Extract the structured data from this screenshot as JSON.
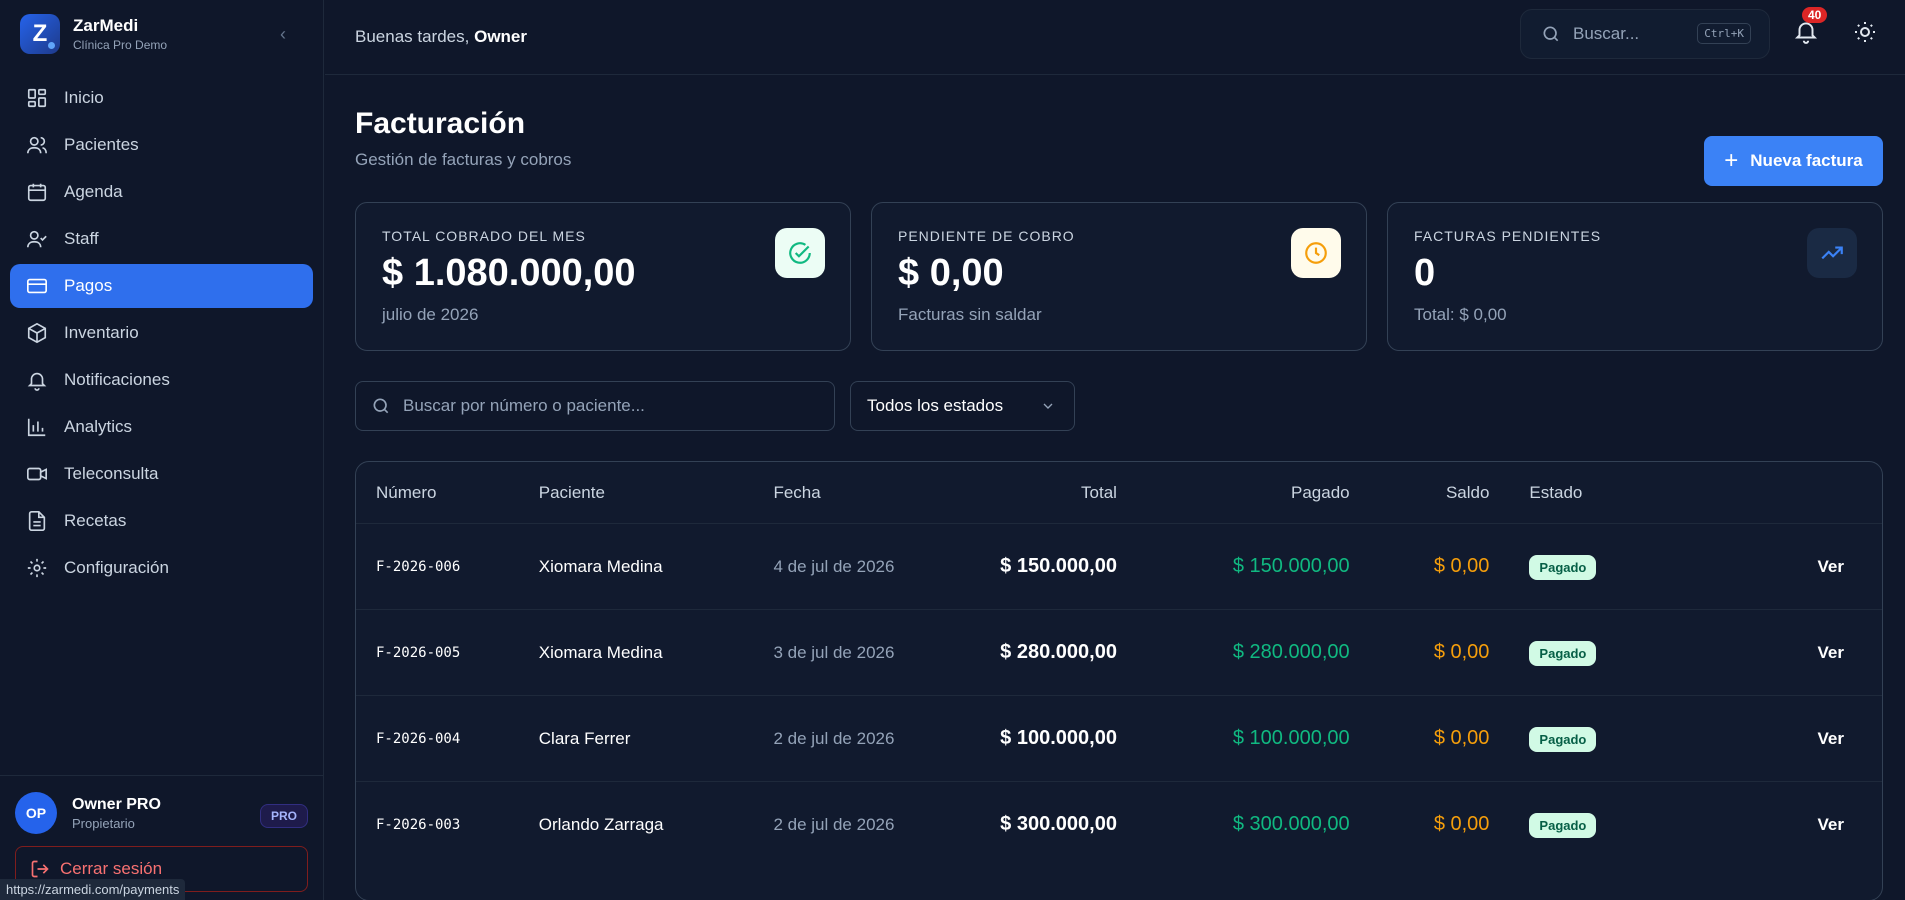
{
  "sidebar": {
    "brand_name": "ZarMedi",
    "brand_sub": "Clínica Pro Demo",
    "logo_letter": "Z",
    "items": [
      {
        "label": "Inicio",
        "icon": "grid-icon"
      },
      {
        "label": "Pacientes",
        "icon": "users-icon"
      },
      {
        "label": "Agenda",
        "icon": "calendar-icon"
      },
      {
        "label": "Staff",
        "icon": "user-check-icon"
      },
      {
        "label": "Pagos",
        "icon": "credit-card-icon",
        "active": true
      },
      {
        "label": "Inventario",
        "icon": "box-icon"
      },
      {
        "label": "Notificaciones",
        "icon": "bell-icon"
      },
      {
        "label": "Analytics",
        "icon": "bar-chart-icon"
      },
      {
        "label": "Teleconsulta",
        "icon": "video-icon"
      },
      {
        "label": "Recetas",
        "icon": "file-text-icon"
      },
      {
        "label": "Configuración",
        "icon": "gear-icon"
      }
    ],
    "user": {
      "initials": "OP",
      "name": "Owner PRO",
      "role": "Propietario",
      "badge": "PRO"
    },
    "logout": "Cerrar sesión",
    "url_tooltip": "https://zarmedi.com/payments"
  },
  "topbar": {
    "greeting": "Buenas tardes,",
    "greeting_name": "Owner",
    "search_placeholder": "Buscar...",
    "shortcut": "Ctrl+K",
    "notif_count": "40"
  },
  "page": {
    "title": "Facturación",
    "subtitle": "Gestión de facturas y cobros",
    "new_button": "Nueva factura"
  },
  "stats": [
    {
      "label": "TOTAL COBRADO DEL MES",
      "value": "$ 1.080.000,00",
      "note": "julio de 2026",
      "icon": "check-circle-icon",
      "icon_bg": "#ecfdf5",
      "icon_color": "#10b981"
    },
    {
      "label": "PENDIENTE DE COBRO",
      "value": "$ 0,00",
      "note": "Facturas sin saldar",
      "icon": "clock-icon",
      "icon_bg": "#fffbeb",
      "icon_color": "#f59e0b"
    },
    {
      "label": "FACTURAS PENDIENTES",
      "value": "0",
      "note": "Total: $ 0,00",
      "icon": "trending-up-icon",
      "icon_bg": "#1a2a44",
      "icon_color": "#3b82f6"
    }
  ],
  "filters": {
    "search_placeholder": "Buscar por número o paciente...",
    "status_select": "Todos los estados"
  },
  "table": {
    "headers": [
      "Número",
      "Paciente",
      "Fecha",
      "Total",
      "Pagado",
      "Saldo",
      "Estado",
      ""
    ],
    "rows": [
      {
        "numero": "F-2026-006",
        "paciente": "Xiomara Medina",
        "fecha": "4 de jul de 2026",
        "total": "$ 150.000,00",
        "pagado": "$ 150.000,00",
        "saldo": "$ 0,00",
        "estado": "Pagado",
        "accion": "Ver"
      },
      {
        "numero": "F-2026-005",
        "paciente": "Xiomara Medina",
        "fecha": "3 de jul de 2026",
        "total": "$ 280.000,00",
        "pagado": "$ 280.000,00",
        "saldo": "$ 0,00",
        "estado": "Pagado",
        "accion": "Ver"
      },
      {
        "numero": "F-2026-004",
        "paciente": "Clara Ferrer",
        "fecha": "2 de jul de 2026",
        "total": "$ 100.000,00",
        "pagado": "$ 100.000,00",
        "saldo": "$ 0,00",
        "estado": "Pagado",
        "accion": "Ver"
      },
      {
        "numero": "F-2026-003",
        "paciente": "Orlando Zarraga",
        "fecha": "2 de jul de 2026",
        "total": "$ 300.000,00",
        "pagado": "$ 300.000,00",
        "saldo": "$ 0,00",
        "estado": "Pagado",
        "accion": "Ver"
      }
    ]
  }
}
